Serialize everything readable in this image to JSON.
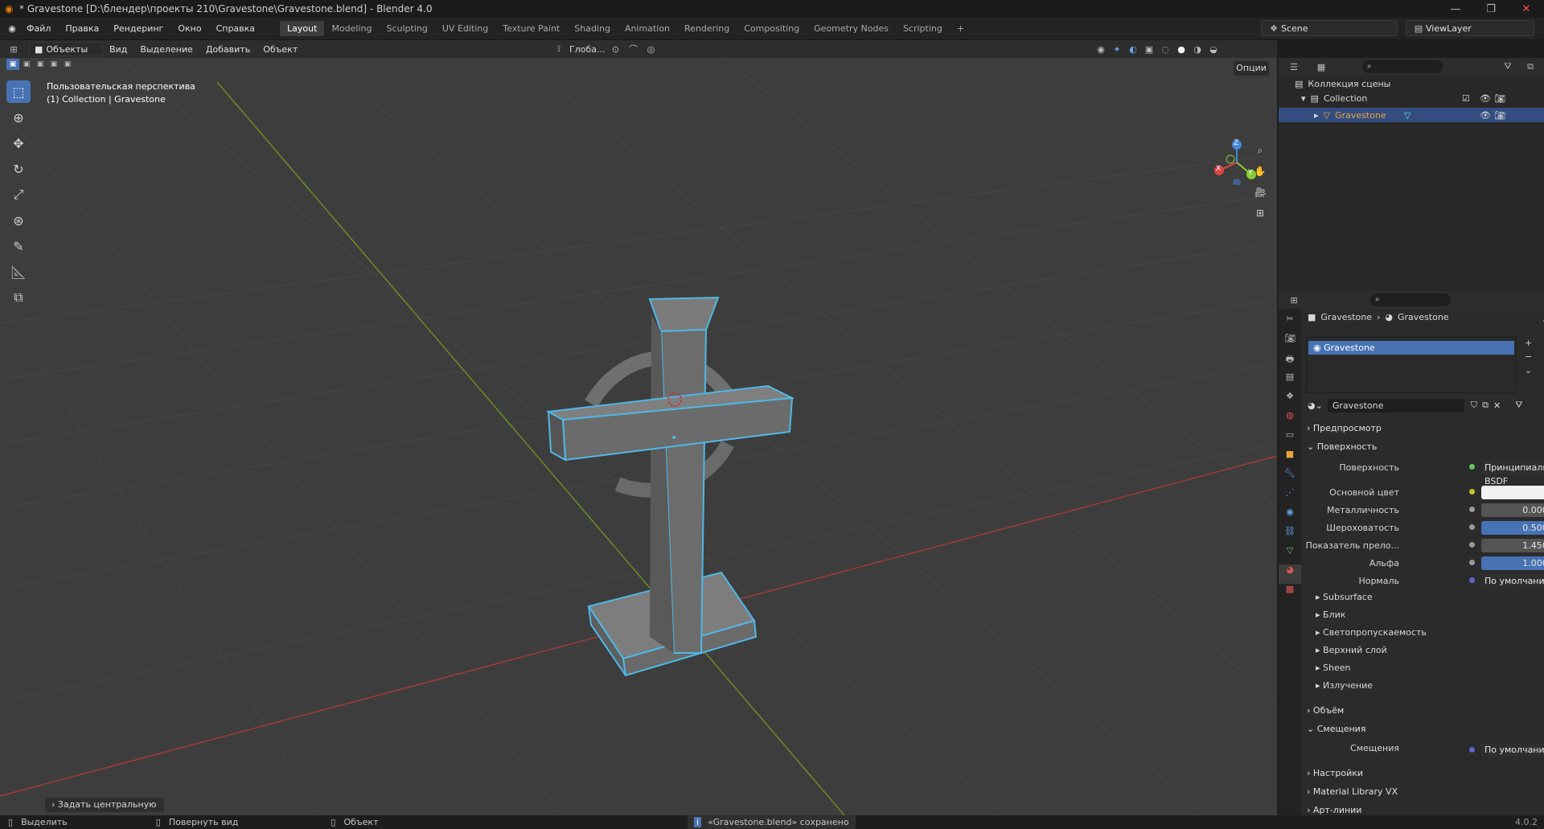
{
  "titlebar": {
    "title": "* Gravestone [D:\\блендер\\проекты 210\\Gravestone\\Gravestone.blend] - Blender 4.0",
    "minimize": "—",
    "maximize": "❐",
    "close": "✕"
  },
  "menus": [
    "Файл",
    "Правка",
    "Рендеринг",
    "Окно",
    "Справка"
  ],
  "workspaces": [
    "Layout",
    "Modeling",
    "Sculpting",
    "UV Editing",
    "Texture Paint",
    "Shading",
    "Animation",
    "Rendering",
    "Compositing",
    "Geometry Nodes",
    "Scripting"
  ],
  "active_workspace": "Layout",
  "add_tab": "+",
  "scene": {
    "name": "Scene",
    "view_layer": "ViewLayer"
  },
  "viewport_header": {
    "mode": "Объекты",
    "menus": [
      "Вид",
      "Выделение",
      "Добавить",
      "Объект"
    ],
    "transform": "Глоба...",
    "options": "Опции"
  },
  "viewport": {
    "perspective": "Пользовательская перспектива",
    "collection_info": "(1) Collection | Gravestone",
    "axes": [
      "X",
      "Y",
      "Z"
    ],
    "operator_panel": "Задать центральную точ"
  },
  "outliner": {
    "root": "Коллекция сцены",
    "items": [
      {
        "label": "Collection"
      },
      {
        "label": "Gravestone",
        "selected": true
      }
    ]
  },
  "properties": {
    "breadcrumb": [
      "Gravestone",
      "Gravestone"
    ],
    "material_slot": "Gravestone",
    "material_name": "Gravestone",
    "sections": {
      "preview": "Предпросмотр",
      "surface": "Поверхность",
      "volume": "Объём",
      "displacement": "Смещения",
      "settings": "Настройки",
      "material_library": "Material Library VX",
      "lineart": "Арт-линии"
    },
    "surface_rows": [
      {
        "label": "Поверхность",
        "value": "Принципиальный BSDF",
        "dot": "green"
      },
      {
        "label": "Основной цвет",
        "value": "",
        "dot": "yellow",
        "white": true
      },
      {
        "label": "Металличность",
        "value": "0.000",
        "dot": "gray"
      },
      {
        "label": "Шероховатость",
        "value": "0.500",
        "dot": "gray",
        "blue": true
      },
      {
        "label": "Показатель прело...",
        "value": "1.450",
        "dot": "gray"
      },
      {
        "label": "Альфа",
        "value": "1.000",
        "dot": "gray",
        "blue": true
      },
      {
        "label": "Нормаль",
        "value": "По умолчанию",
        "dot": "purple"
      }
    ],
    "subsections": [
      "Subsurface",
      "Блик",
      "Светопропускаемость",
      "Верхний слой",
      "Sheen",
      "Излучение"
    ],
    "displacement_row": {
      "label": "Смещения",
      "value": "По умолчанию"
    }
  },
  "statusbar": {
    "select": "Выделить",
    "rotate": "Повернуть вид",
    "object": "Объект",
    "message": "«Gravestone.blend» сохранено",
    "version": "4.0.2"
  },
  "colors": {
    "accent": "#4772b3",
    "selection_outline": "#4fb8e6",
    "x_axis": "#c73a3a",
    "y_axis": "#7a9a2a",
    "active_object": "#e8a33a"
  }
}
